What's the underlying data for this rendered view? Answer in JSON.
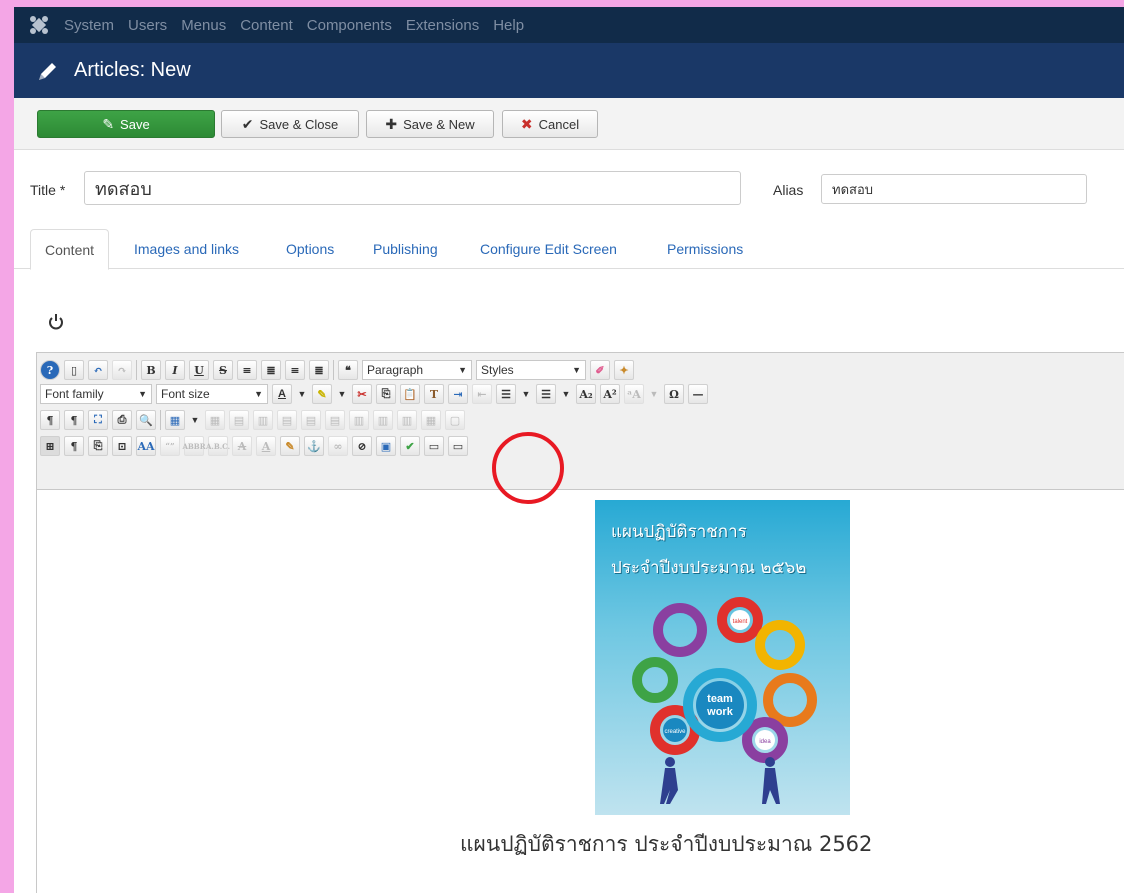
{
  "topnav": {
    "items": [
      "System",
      "Users",
      "Menus",
      "Content",
      "Components",
      "Extensions",
      "Help"
    ]
  },
  "header": {
    "title": "Articles: New"
  },
  "toolbar": {
    "save_label": "Save",
    "save_close_label": "Save & Close",
    "save_new_label": "Save & New",
    "cancel_label": "Cancel"
  },
  "form": {
    "title_label": "Title *",
    "title_value": "ทดสอบ",
    "alias_label": "Alias",
    "alias_value": "ทดสอบ"
  },
  "tabs": [
    "Content",
    "Images and links",
    "Options",
    "Publishing",
    "Configure Edit Screen",
    "Permissions"
  ],
  "editor": {
    "format_select": "Paragraph",
    "styles_select": "Styles",
    "font_family_select": "Font family",
    "font_size_select": "Font size",
    "image_text_line1": "แผนปฏิบัติราชการ",
    "image_text_line2": "ประจำปีงบประมาณ ๒๕๖๒",
    "image_badge_team": "team",
    "image_badge_work": "work",
    "image_badge_creative": "creative",
    "image_badge_idea": "idea",
    "image_badge_talent": "talent",
    "caption": "แผนปฏิบัติราชการ ประจำปีงบประมาณ 2562"
  },
  "colors": {
    "topbar": "#112b49",
    "header": "#1a3867",
    "save_button": "#2d8a35",
    "highlight_circle": "#e81923",
    "page_frame": "#f4a6e6"
  }
}
